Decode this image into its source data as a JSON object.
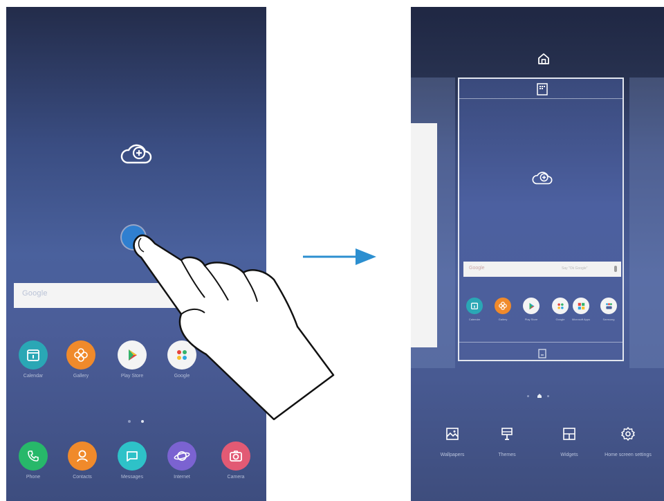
{
  "left_screen": {
    "search_logo": "Google",
    "apps": [
      {
        "label": "Calendar",
        "icon": "calendar-icon",
        "color": "#2aa7b5"
      },
      {
        "label": "Gallery",
        "icon": "flower-icon",
        "color": "#f08a2b"
      },
      {
        "label": "Play Store",
        "icon": "play-store-icon",
        "color": "#f4f4f4"
      },
      {
        "label": "Google",
        "icon": "google-folder-icon",
        "color": "#f4f4f4"
      }
    ],
    "dock": [
      {
        "label": "Phone",
        "icon": "phone-icon",
        "color": "#27b86a"
      },
      {
        "label": "Contacts",
        "icon": "contacts-icon",
        "color": "#f08a2b"
      },
      {
        "label": "Messages",
        "icon": "messages-icon",
        "color": "#2ec2c8"
      },
      {
        "label": "Internet",
        "icon": "internet-icon",
        "color": "#7b63d1"
      },
      {
        "label": "Camera",
        "icon": "camera-icon",
        "color": "#e25a74"
      }
    ]
  },
  "right_screen": {
    "search_logo": "Google",
    "search_hint": "Say \"Ok Google\"",
    "apps": [
      {
        "label": "Calendar",
        "color": "#2aa7b5"
      },
      {
        "label": "Gallery",
        "color": "#f08a2b"
      },
      {
        "label": "Play Store",
        "color": "#f4f4f4"
      },
      {
        "label": "Google",
        "color": "#f4f4f4"
      },
      {
        "label": "Microsoft Apps",
        "color": "#f4f4f4"
      },
      {
        "label": "Samsung",
        "color": "#f4f4f4"
      }
    ],
    "bottom_bar": [
      {
        "label": "Wallpapers",
        "icon": "wallpaper-icon"
      },
      {
        "label": "Themes",
        "icon": "themes-icon"
      },
      {
        "label": "Widgets",
        "icon": "widgets-icon"
      },
      {
        "label": "Home screen settings",
        "icon": "gear-icon"
      }
    ]
  },
  "colors": {
    "arrow": "#2c8fd0",
    "touch": "#2f7fd0"
  }
}
